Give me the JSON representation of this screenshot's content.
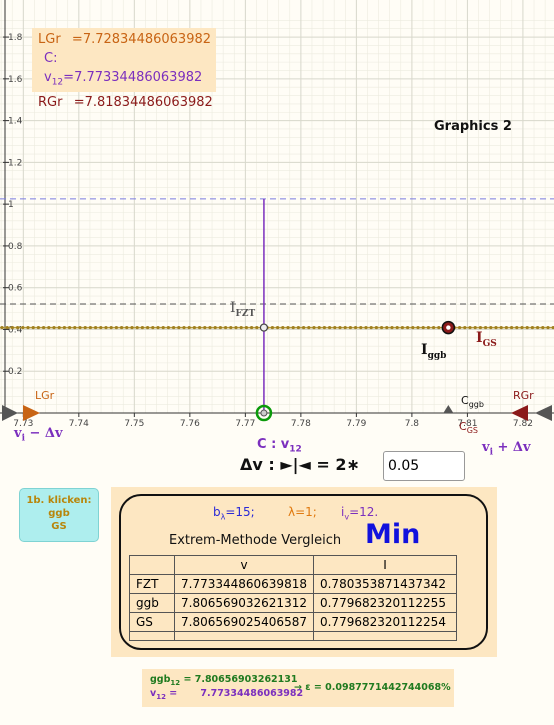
{
  "colors": {
    "lgr": "#c86414",
    "c": "#7b2fbe",
    "rgr": "#8b1a1a",
    "ggb": "#b8860b",
    "dv": "#2a2ad6",
    "green": "#0a8a0a"
  },
  "infobox": {
    "lgr_label": "LGr",
    "lgr_eq": "=",
    "lgr_value": "7.72834486063982",
    "c_label": "C: v",
    "c_sub": "12",
    "c_eq": "=",
    "c_value": "7.77334486063982",
    "rgr_label": "RGr",
    "rgr_eq": "=",
    "rgr_value": "7.81834486063982"
  },
  "graphics_title": "Graphics 2",
  "axes": {
    "x_ticks": [
      "7.73",
      "7.74",
      "7.75",
      "7.76",
      "7.77",
      "7.78",
      "7.79",
      "7.8",
      "7.81",
      "7.82"
    ],
    "y_ticks": [
      "0.2",
      "0.4",
      "0.6",
      "0.8",
      "1",
      "1.2",
      "1.4",
      "1.6",
      "1.8"
    ],
    "xlim": [
      7.7258,
      7.8256
    ],
    "ylim": [
      0,
      1.92
    ]
  },
  "curves": {
    "dashed_blue_y": 1.025,
    "dashed_gray_y": 0.522,
    "dotted_y": 0.409
  },
  "points": {
    "c_x": 7.77334486063982,
    "c_y": 0.409,
    "ggb_x": 7.806569032621312,
    "ggb_y": 0.409,
    "gs_x": 7.806569025406587
  },
  "labels": {
    "i_fzt": "I",
    "i_fzt_sub": "FZT",
    "i_ggb": "I",
    "i_ggb_sub": "ggb",
    "i_gs": "I",
    "i_gs_sub": "GS",
    "lgr": "LGr",
    "rgr": "RGr",
    "c_ggb": "C",
    "c_ggb_sub": "ggb",
    "c_gs": "C",
    "c_gs_sub": "GS",
    "vi_minus": "v",
    "vi_minus_sub": "i",
    "vi_minus_rest": " − Δv",
    "vi_plus": "v",
    "vi_plus_sub": "i",
    "vi_plus_rest": " + Δv",
    "c_v12": "C : v",
    "c_v12_sub": "12"
  },
  "delta_v": {
    "label": "Δv : ►|◄ = 2∗",
    "value": "0.05"
  },
  "button": {
    "line1": "1b. klicken:",
    "line2": "ggb",
    "line3": "GS"
  },
  "results": {
    "b_label": "b",
    "b_sub": "λ",
    "b_value": "=15;",
    "lambda_label": "λ=1;",
    "i_label": "i",
    "i_sub": "v",
    "i_value": "=12.",
    "method_title": "Extrem-Methode Vergleich",
    "min_label": "Min",
    "headers": [
      "",
      "v",
      "I"
    ],
    "rows": [
      [
        "FZT",
        "7.773344860639818",
        "0.780353871437342"
      ],
      [
        "ggb",
        "7.806569032621312",
        "0.779682320112255"
      ],
      [
        "GS",
        "7.806569025406587",
        "0.779682320112254"
      ],
      [
        "",
        "",
        ""
      ]
    ]
  },
  "bottom": {
    "ggb_label": "ggb",
    "ggb_sub": "12",
    "ggb_eq": " = 7.80656903262131",
    "v_label": "v",
    "v_sub": "12",
    "v_eq": " =       7.77334486063982",
    "arrow": "→ ε = 0.0987771442744068%"
  }
}
